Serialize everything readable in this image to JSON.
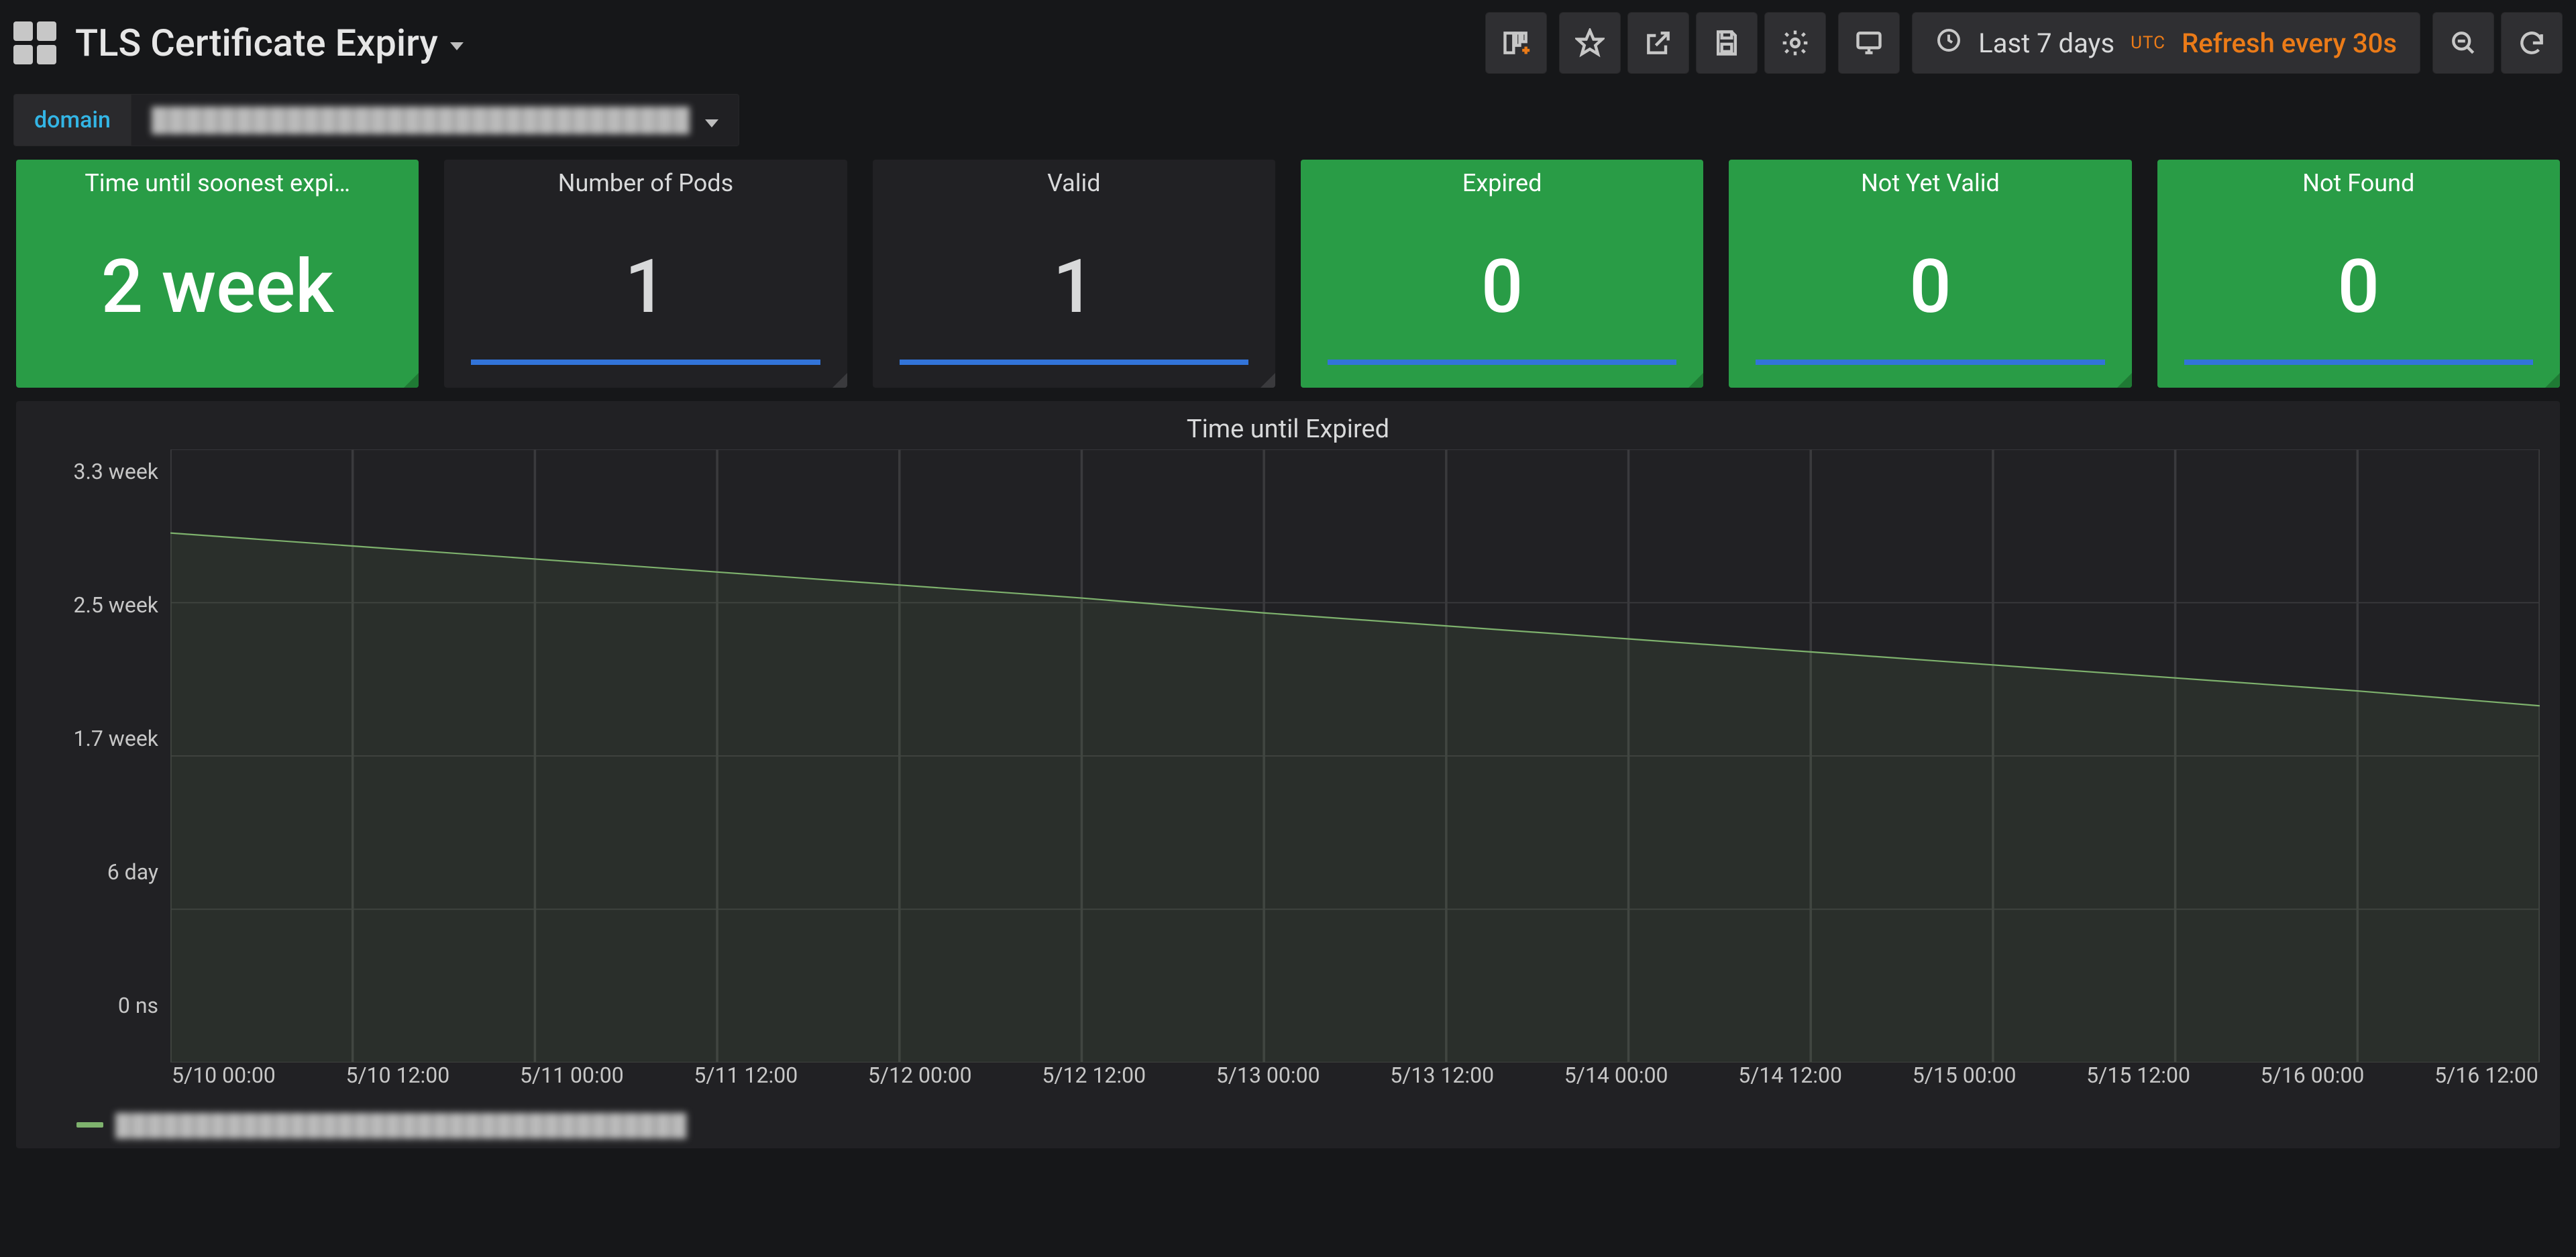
{
  "header": {
    "dashboard_title": "TLS Certificate Expiry",
    "time_range": "Last 7 days",
    "timezone": "UTC",
    "refresh_text": "Refresh every 30s"
  },
  "variables": {
    "domain_label": "domain",
    "domain_value": "████████████████████████████████"
  },
  "stats": [
    {
      "title": "Time until soonest expi…",
      "value": "2 week",
      "style": "green",
      "spark": false
    },
    {
      "title": "Number of Pods",
      "value": "1",
      "style": "dark",
      "spark": true
    },
    {
      "title": "Valid",
      "value": "1",
      "style": "dark",
      "spark": true
    },
    {
      "title": "Expired",
      "value": "0",
      "style": "green",
      "spark": true
    },
    {
      "title": "Not Yet Valid",
      "value": "0",
      "style": "green",
      "spark": true
    },
    {
      "title": "Not Found",
      "value": "0",
      "style": "green",
      "spark": true
    }
  ],
  "graph": {
    "title": "Time until Expired",
    "y_ticks": [
      "3.3 week",
      "2.5 week",
      "1.7 week",
      "6 day",
      "0 ns"
    ],
    "x_ticks": [
      "5/10 00:00",
      "5/10 12:00",
      "5/11 00:00",
      "5/11 12:00",
      "5/12 00:00",
      "5/12 12:00",
      "5/13 00:00",
      "5/13 12:00",
      "5/14 00:00",
      "5/14 12:00",
      "5/15 00:00",
      "5/15 12:00",
      "5/16 00:00",
      "5/16 12:00"
    ],
    "legend_series": "████████████████████████████████████"
  },
  "chart_data": {
    "type": "line",
    "title": "Time until Expired",
    "xlabel": "",
    "ylabel": "",
    "y_unit": "weeks",
    "ylim_weeks": [
      0,
      3.3
    ],
    "x": [
      "5/10 00:00",
      "5/10 12:00",
      "5/11 00:00",
      "5/11 12:00",
      "5/12 00:00",
      "5/12 12:00",
      "5/13 00:00",
      "5/13 12:00",
      "5/14 00:00",
      "5/14 12:00",
      "5/15 00:00",
      "5/15 12:00",
      "5/16 00:00",
      "5/16 12:00"
    ],
    "series": [
      {
        "name": "(redacted)",
        "color": "#7eb26d",
        "values_weeks": [
          2.85,
          2.78,
          2.71,
          2.64,
          2.57,
          2.5,
          2.42,
          2.35,
          2.28,
          2.21,
          2.14,
          2.07,
          2.0,
          1.92
        ]
      }
    ],
    "y_tick_labels": [
      "3.3 week",
      "2.5 week",
      "1.7 week",
      "6 day",
      "0 ns"
    ],
    "grid": true,
    "legend_position": "bottom-left"
  }
}
